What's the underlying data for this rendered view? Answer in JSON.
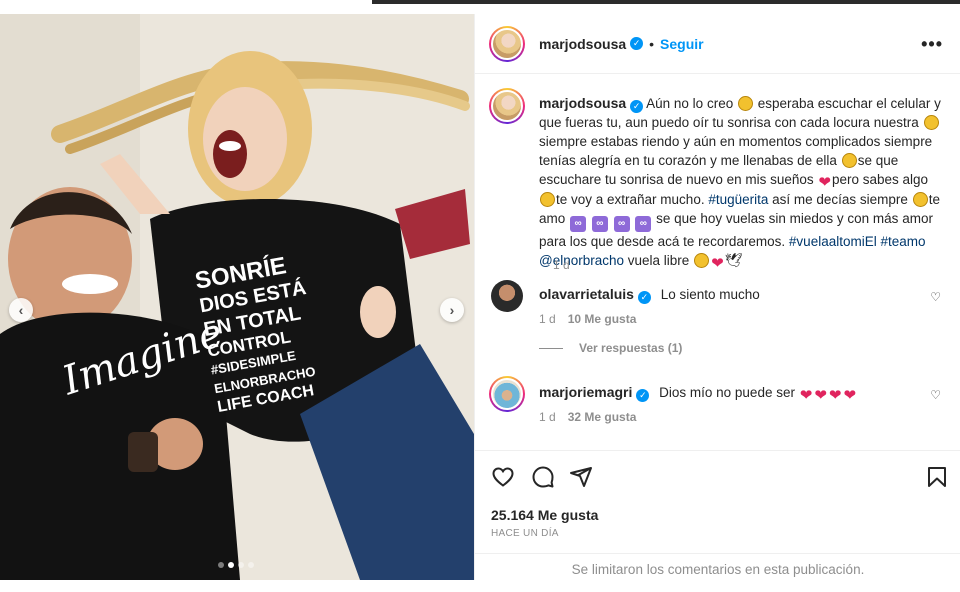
{
  "post": {
    "author": "marjodsousa",
    "follow_label": "Seguir",
    "more_label": "•••",
    "verified_mark": "✓"
  },
  "media": {
    "shirt_left_text": "Imagine",
    "shirt_right_lines": [
      "SONRÍE",
      "DIOS ESTÁ",
      "EN TOTAL",
      "CONTROL",
      "#SIDESIMPLE",
      "ELNORBRACHO",
      "LIFE COACH"
    ],
    "carousel_count": 4,
    "carousel_active": 2
  },
  "caption": {
    "username": "marjodsousa",
    "p1": " Aún no lo creo ",
    "p2": " esperaba escuchar el celular y que fueras tu, aun puedo oír tu sonrisa con cada locura nuestra ",
    "p3": " siempre estabas riendo y aún en momentos complicados siempre tenías alegría en tu corazón y me llenabas de ella ",
    "p4": "se que escuchare tu sonrisa de nuevo en mis sueños ",
    "p5": "pero sabes algo ",
    "p6": "te voy a extrañar mucho. ",
    "tag1": "#tugüerita",
    "p7": " así me decías siempre ",
    "p8": "te amo ",
    "p9": " se que hoy vuelas sin miedos y con más amor para los que desde acá te recordaremos.",
    "tag2": "#vuelaaltomiEl",
    "tag3": "#teamo",
    "mention": "@elnorbracho",
    "p10": " vuela libre ",
    "time": "1 d"
  },
  "comments": [
    {
      "username": "olavarrietaluis",
      "text": "Lo siento mucho",
      "time": "1 d",
      "likes": "10 Me gusta",
      "replies": "Ver respuestas (1)"
    },
    {
      "username": "marjoriemagri",
      "text": "Dios mío no puede ser",
      "time": "1 d",
      "likes": "32 Me gusta"
    }
  ],
  "stats": {
    "likes": "25.164 Me gusta",
    "ago": "HACE UN DÍA",
    "comments_limited": "Se limitaron los comentarios en esta publicación."
  },
  "colors": {
    "accent": "#0095f6",
    "muted": "#8e8e8e",
    "text": "#262626",
    "heart": "#e0245e"
  }
}
